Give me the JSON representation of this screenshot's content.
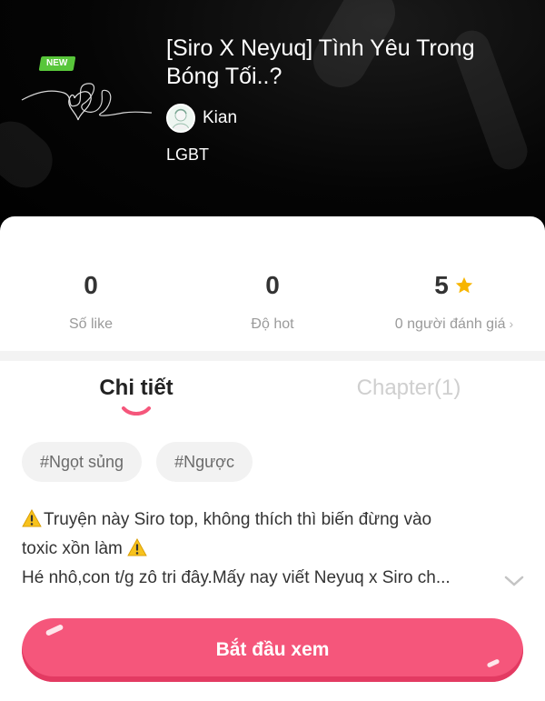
{
  "header": {
    "badge": "NEW",
    "title": "[Siro X Neyuq] Tình Yêu Trong Bóng Tối..?",
    "author": "Kian",
    "genre": "LGBT"
  },
  "stats": [
    {
      "value": "0",
      "label": "Số like"
    },
    {
      "value": "0",
      "label": "Độ hot"
    },
    {
      "value": "5",
      "label": "0 người đánh giá",
      "icon": "star-icon"
    }
  ],
  "tabs": {
    "details": "Chi tiết",
    "chapters": "Chapter(1)"
  },
  "tags": [
    "#Ngọt sủng",
    "#Ngược"
  ],
  "description": {
    "line1": "Truyện này Siro top, không thích thì biến đừng vào",
    "line2": "toxic xồn làm",
    "line3": "Hé nhô,con t/g zô tri đây.Mấy nay viết Neyuq x Siro ch..."
  },
  "actions": {
    "start": "Bắt đầu xem"
  },
  "colors": {
    "accent": "#f5567b",
    "badge": "#58c63a",
    "star": "#f7b500"
  }
}
